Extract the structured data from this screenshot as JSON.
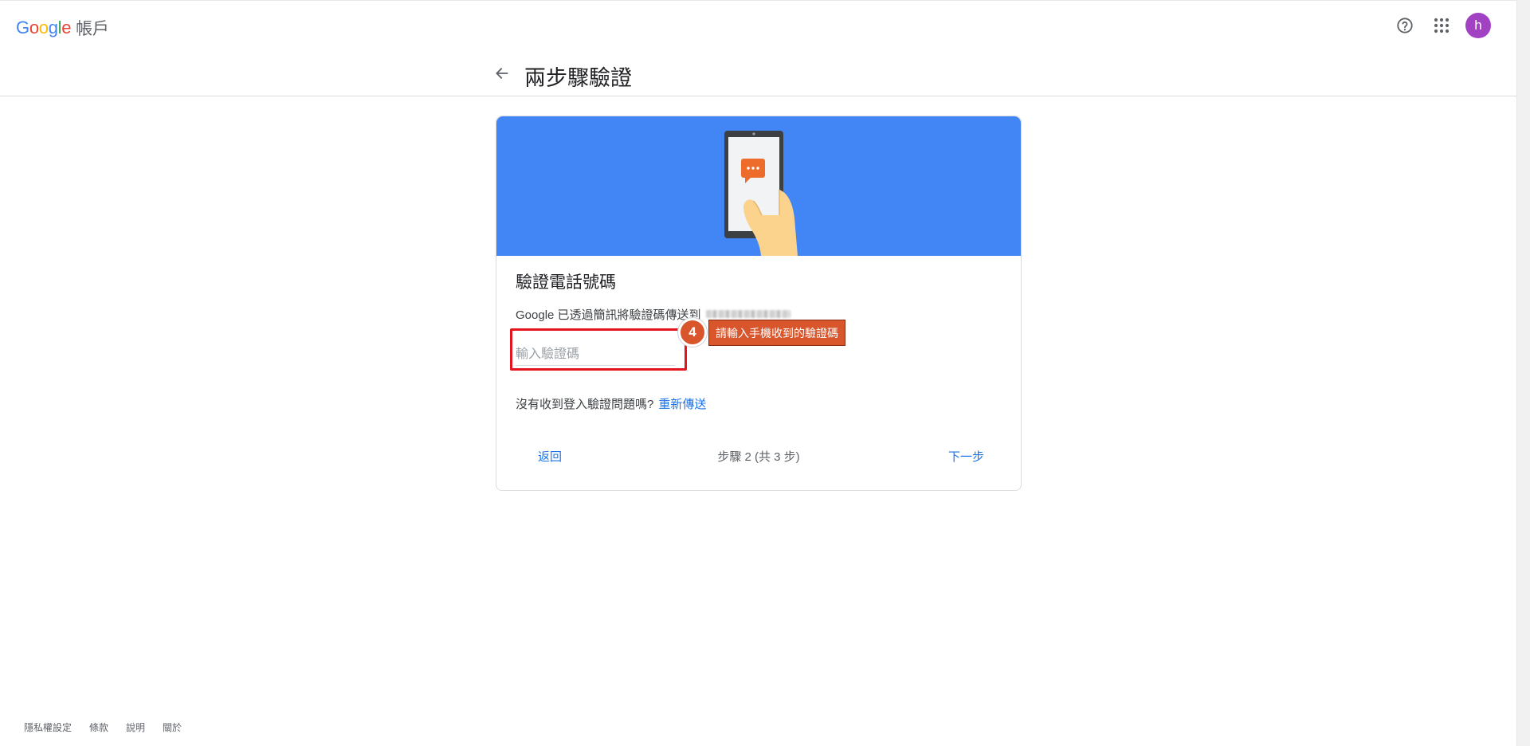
{
  "header": {
    "logo_g1": "G",
    "logo_o1": "o",
    "logo_o2": "o",
    "logo_g2": "g",
    "logo_l": "l",
    "logo_e": "e",
    "product_name": "帳戶",
    "avatar_initial": "h",
    "icons": [
      "help-icon",
      "apps-icon"
    ]
  },
  "page": {
    "title": "兩步驟驗證"
  },
  "card": {
    "heading": "驗證電話號碼",
    "description": "Google 已透過簡訊將驗證碼傳送到",
    "input_placeholder": "輸入驗證碼",
    "resend_prompt": "沒有收到登入驗證問題嗎?",
    "resend_link": "重新傳送",
    "back_label": "返回",
    "step_indicator": "步驟 2 (共 3 步)",
    "next_label": "下一步"
  },
  "annotation": {
    "step_number": "4",
    "label": "請輸入手機收到的驗證碼"
  },
  "footer": {
    "links": [
      "隱私權設定",
      "條款",
      "說明",
      "關於"
    ]
  },
  "colors": {
    "hero_blue": "#4285f4",
    "link_blue": "#1a73e8",
    "avatar_purple": "#a142c2",
    "annotation_orange": "#d9552c",
    "highlight_red": "#e4151f"
  }
}
